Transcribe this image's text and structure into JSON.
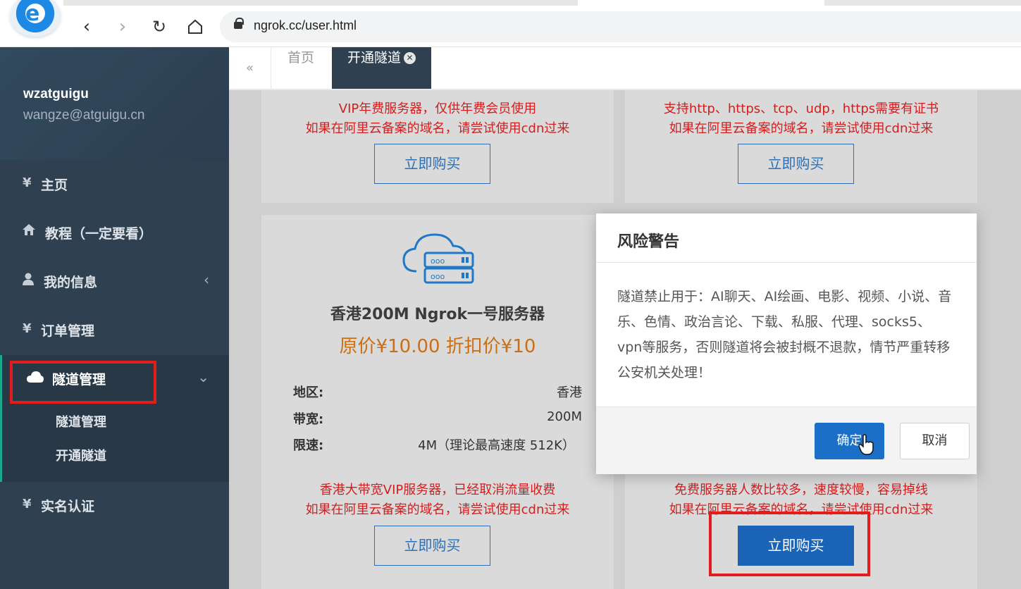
{
  "browser": {
    "url": "ngrok.cc/user.html",
    "logo_glyph": "e"
  },
  "sidebar": {
    "username": "wzatguigu",
    "email": "wangze@atguigu.cn",
    "items": [
      {
        "icon": "¥",
        "label": "主页"
      },
      {
        "icon": "home-icon",
        "label": "教程（一定要看）"
      },
      {
        "icon": "user-icon",
        "label": "我的信息",
        "caret": "‹"
      },
      {
        "icon": "¥",
        "label": "订单管理"
      },
      {
        "icon": "cloud-icon",
        "label": "隧道管理",
        "caret": "⌄"
      },
      {
        "icon": "¥",
        "label": "实名认证"
      }
    ],
    "sub_items": [
      "隧道管理",
      "开通隧道"
    ]
  },
  "tabs": {
    "back": "«",
    "items": [
      "首页",
      "开通隧道"
    ],
    "close": "✕"
  },
  "cards": {
    "top_left": {
      "line1": "VIP年费服务器，仅供年费会员使用",
      "line2": "如果在阿里云备案的域名，请尝试使用cdn过来",
      "button": "立即购买"
    },
    "top_right": {
      "line1": "支持http、https、tcp、udp，https需要有证书",
      "line2": "如果在阿里云备案的域名，请尝试使用cdn过来",
      "button": "立即购买"
    },
    "hk": {
      "title": "香港200M Ngrok一号服务器",
      "price": "原价¥10.00    折扣价¥10",
      "spec_region_key": "地区:",
      "spec_region_val": "香港",
      "spec_bw_key": "带宽:",
      "spec_bw_val": "200M",
      "spec_limit_key": "限速:",
      "spec_limit_val": "4M（理论最高速度 512K）",
      "line1": "香港大带宽VIP服务器，已经取消流量收费",
      "line2": "如果在阿里云备案的域名，请尝试使用cdn过来",
      "button": "立即购买"
    },
    "free": {
      "line1": "免费服务器人数比较多，速度较慢，容易掉线",
      "line2": "如果在阿里云备案的域名，请尝试使用cdn过来",
      "button": "立即购买"
    }
  },
  "modal": {
    "title": "风险警告",
    "body": "隧道禁止用于：AI聊天、AI绘画、电影、视频、小说、音乐、色情、政治言论、下载、私服、代理、socks5、vpn等服务，否则隧道将会被封概不退款，情节严重转移公安机关处理！",
    "ok": "确定",
    "cancel": "取消"
  },
  "colors": {
    "sidebar_bg": "#2f4050",
    "highlight_red": "#e31c1c",
    "primary_blue": "#1c6fc6",
    "warning_text": "#d21e1e",
    "price_orange": "#cc6e12"
  }
}
